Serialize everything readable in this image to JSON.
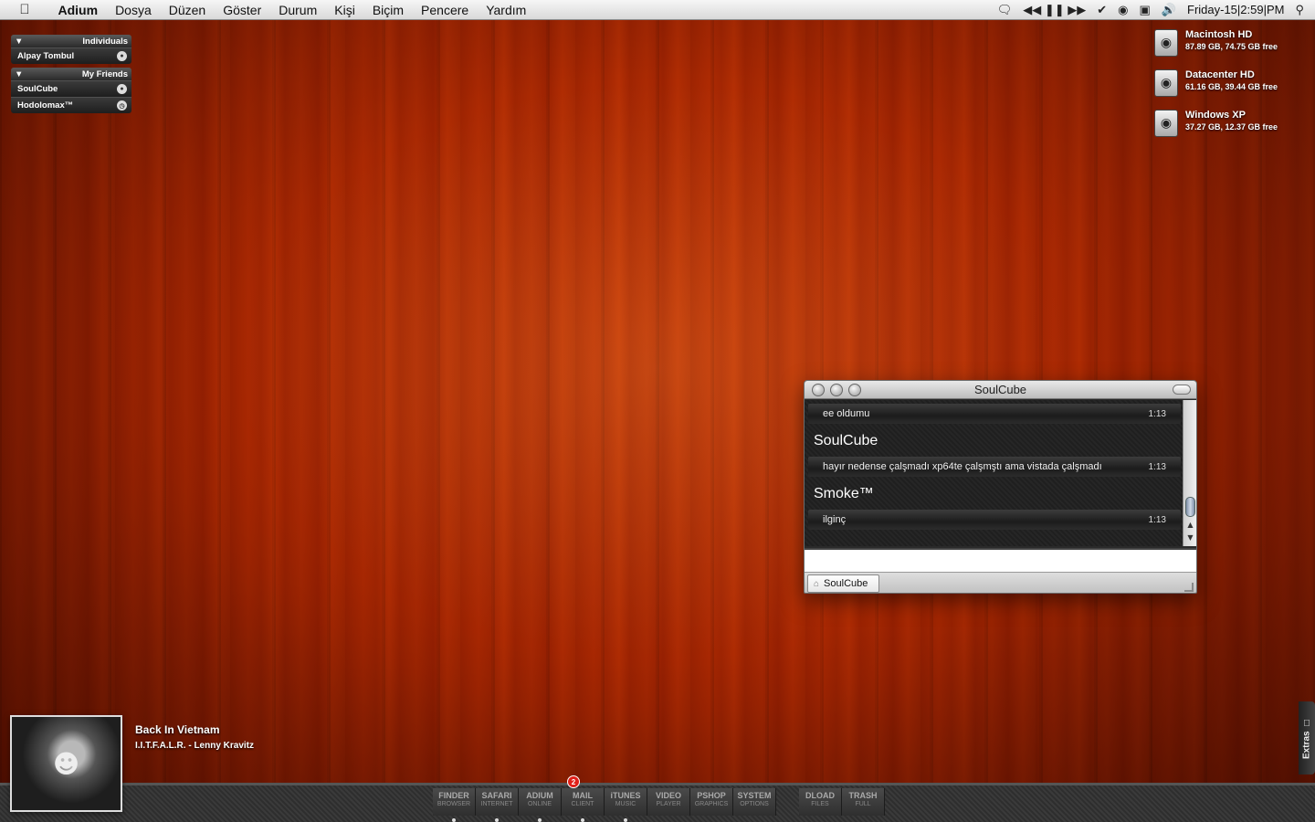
{
  "menubar": {
    "app_name": "Adium",
    "items": [
      "Dosya",
      "Düzen",
      "Göster",
      "Durum",
      "Kişi",
      "Biçim",
      "Pencere",
      "Yardım"
    ],
    "clock": "Friday-15|2:59|PM"
  },
  "contacts": {
    "groups": [
      {
        "name": "Individuals",
        "members": [
          {
            "name": "Alpay Tombul"
          }
        ]
      },
      {
        "name": "My Friends",
        "members": [
          {
            "name": "SoulCube"
          },
          {
            "name": "Hodolomax™"
          }
        ]
      }
    ]
  },
  "drives": [
    {
      "name": "Macintosh HD",
      "info": "87.89 GB, 74.75 GB free"
    },
    {
      "name": "Datacenter HD",
      "info": "61.16 GB, 39.44 GB free"
    },
    {
      "name": "Windows XP",
      "info": "37.27 GB, 12.37 GB free"
    }
  ],
  "chat": {
    "title": "SoulCube",
    "messages": [
      {
        "sender": "",
        "text": "ee oldumu",
        "time": "1:13"
      },
      {
        "sender": "SoulCube",
        "text": "hayır nedense çalşmadı xp64te çalşmştı ama vistada çalşmadı",
        "time": "1:13"
      },
      {
        "sender": "Smoke™",
        "text": "ilginç",
        "time": "1:13"
      }
    ],
    "tab_label": "SoulCube"
  },
  "now_playing": {
    "title": "Back In Vietnam",
    "artist": "I.I.T.F.A.L.R. - Lenny Kravitz"
  },
  "dock": {
    "items": [
      {
        "main": "FINDER",
        "sub": "BROWSER",
        "running": true
      },
      {
        "main": "SAFARI",
        "sub": "INTERNET",
        "running": true
      },
      {
        "main": "ADIUM",
        "sub": "ONLINE",
        "running": true
      },
      {
        "main": "MAIL",
        "sub": "CLIENT",
        "running": true,
        "badge": "2"
      },
      {
        "main": "iTUNES",
        "sub": "MUSIC",
        "running": true
      },
      {
        "main": "VIDEO",
        "sub": "PLAYER",
        "running": false
      },
      {
        "main": "PSHOP",
        "sub": "GRAPHICS",
        "running": false
      },
      {
        "main": "SYSTEM",
        "sub": "OPTIONS",
        "running": false
      }
    ],
    "right_items": [
      {
        "main": "DLOAD",
        "sub": "FILES"
      },
      {
        "main": "TRASH",
        "sub": "FULL"
      }
    ]
  },
  "extras_label": "Extras"
}
